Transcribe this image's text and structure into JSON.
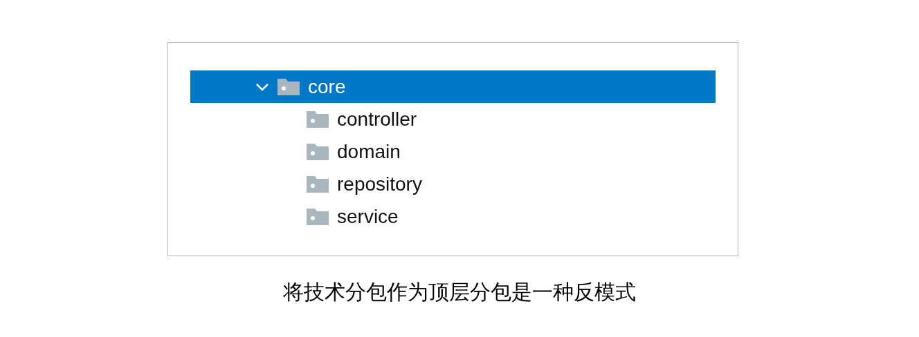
{
  "tree": [
    {
      "label": "core",
      "expanded": true,
      "selected": true,
      "children": [
        {
          "label": "controller",
          "selected": false
        },
        {
          "label": "domain",
          "selected": false
        },
        {
          "label": "repository",
          "selected": false
        },
        {
          "label": "service",
          "selected": false
        }
      ]
    }
  ],
  "caption": "将技术分包作为顶层分包是一种反模式"
}
